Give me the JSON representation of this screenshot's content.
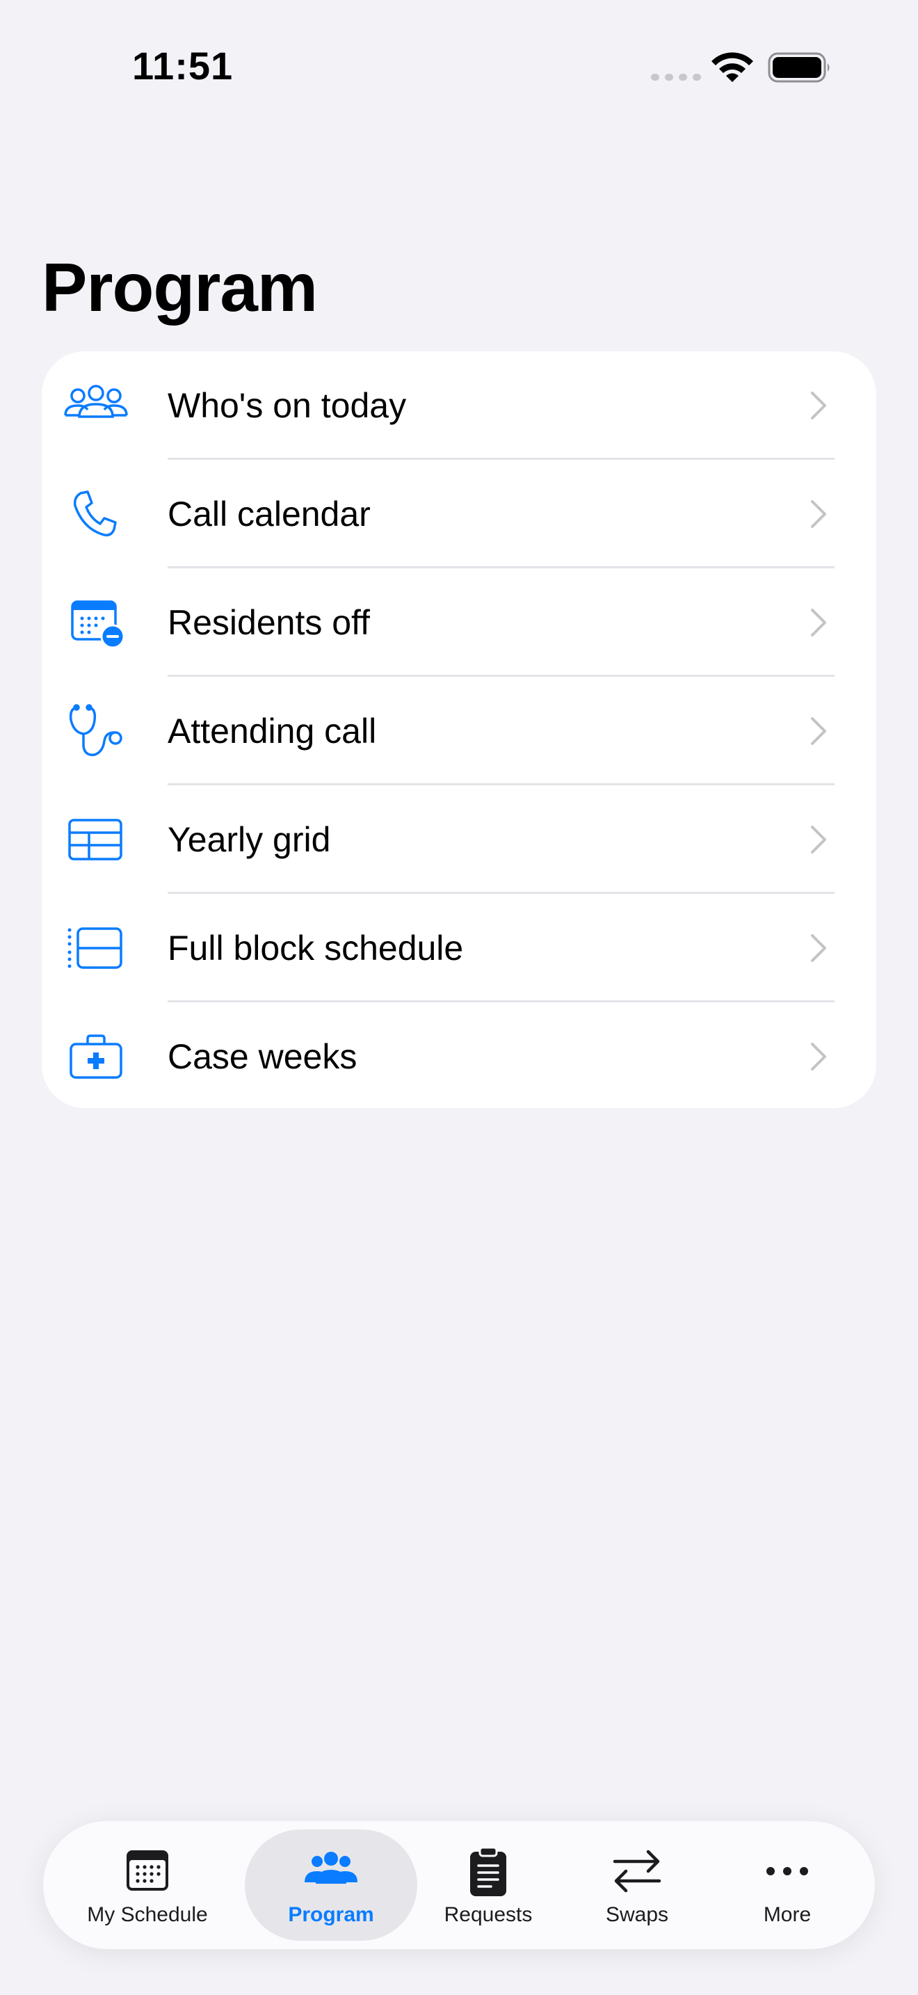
{
  "status_bar": {
    "time": "11:51"
  },
  "page": {
    "title": "Program"
  },
  "menu": {
    "items": [
      {
        "label": "Who's on today",
        "icon": "people-group-icon"
      },
      {
        "label": "Call calendar",
        "icon": "phone-icon"
      },
      {
        "label": "Residents off",
        "icon": "calendar-minus-icon"
      },
      {
        "label": "Attending call",
        "icon": "stethoscope-icon"
      },
      {
        "label": "Yearly grid",
        "icon": "table-grid-icon"
      },
      {
        "label": "Full block schedule",
        "icon": "block-schedule-icon"
      },
      {
        "label": "Case weeks",
        "icon": "medical-kit-icon"
      }
    ]
  },
  "tabbar": {
    "tabs": [
      {
        "label": "My Schedule",
        "icon": "calendar-icon"
      },
      {
        "label": "Program",
        "icon": "people-group-icon",
        "active": true
      },
      {
        "label": "Requests",
        "icon": "clipboard-icon"
      },
      {
        "label": "Swaps",
        "icon": "swap-arrows-icon"
      },
      {
        "label": "More",
        "icon": "ellipsis-icon"
      }
    ]
  },
  "colors": {
    "accent": "#0a7cff",
    "background": "#f2f2f7",
    "card": "#ffffff",
    "separator": "#e3e3e8",
    "chevron": "#c4c4c7"
  }
}
